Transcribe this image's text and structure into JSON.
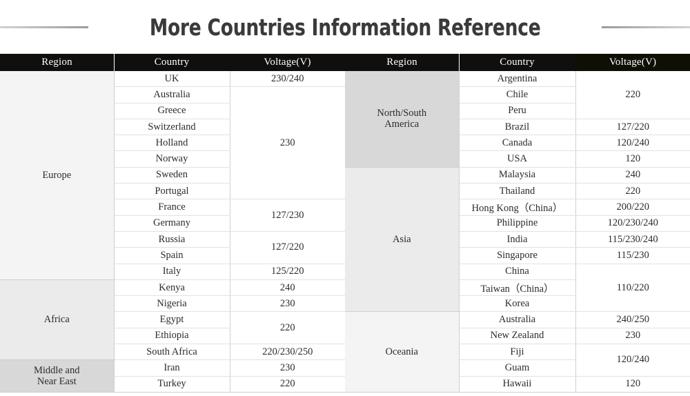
{
  "title": "More Countries Information Reference",
  "headers": {
    "region": "Region",
    "country": "Country",
    "voltage": "Voltage(V)"
  },
  "colors": {
    "header_background": "#100f0d",
    "header_background_tinted": "#100f06",
    "header_text": "#ffffff",
    "title_text": "#3a3a3a",
    "cell_text": "#2b2b2b",
    "grid_line": "#cfcfcf",
    "row_line": "#e2e2e2",
    "region_shade_light": "#f4f4f4",
    "region_shade_mid": "#ebebeb",
    "region_shade_dark": "#d8d8d8",
    "page_background": "#ffffff"
  },
  "left_table": {
    "regions": [
      {
        "label": "Europe",
        "shade": "shade-0",
        "rows": 13
      },
      {
        "label": "Africa",
        "shade": "shade-1",
        "rows": 5
      },
      {
        "label": "Middle and\nNear East",
        "shade": "shade-2",
        "rows": 2
      }
    ],
    "rows": [
      {
        "country": "UK",
        "voltage": "230/240",
        "voltage_rowspan": 1
      },
      {
        "country": "Australia",
        "voltage": "230",
        "voltage_rowspan": 7
      },
      {
        "country": "Greece",
        "voltage": null
      },
      {
        "country": "Switzerland",
        "voltage": null
      },
      {
        "country": "Holland",
        "voltage": null
      },
      {
        "country": "Norway",
        "voltage": null
      },
      {
        "country": "Sweden",
        "voltage": null
      },
      {
        "country": "Portugal",
        "voltage": null
      },
      {
        "country": "France",
        "voltage": "127/230",
        "voltage_rowspan": 2
      },
      {
        "country": "Germany",
        "voltage": null
      },
      {
        "country": "Russia",
        "voltage": "127/220",
        "voltage_rowspan": 2
      },
      {
        "country": "Spain",
        "voltage": null
      },
      {
        "country": "Italy",
        "voltage": "125/220",
        "voltage_rowspan": 1
      },
      {
        "country": "Kenya",
        "voltage": "240",
        "voltage_rowspan": 1
      },
      {
        "country": "Nigeria",
        "voltage": "230",
        "voltage_rowspan": 1
      },
      {
        "country": "Egypt",
        "voltage": "220",
        "voltage_rowspan": 2
      },
      {
        "country": "Ethiopia",
        "voltage": null
      },
      {
        "country": "South Africa",
        "voltage": "220/230/250",
        "voltage_rowspan": 1
      },
      {
        "country": "Iran",
        "voltage": "230",
        "voltage_rowspan": 1
      },
      {
        "country": "Turkey",
        "voltage": "220",
        "voltage_rowspan": 1
      }
    ]
  },
  "right_table": {
    "regions": [
      {
        "label": "North/South\nAmerica",
        "shade": "shade-2",
        "rows": 6
      },
      {
        "label": "Asia",
        "shade": "shade-1",
        "rows": 9
      },
      {
        "label": "Oceania",
        "shade": "shade-0",
        "rows": 5
      }
    ],
    "rows": [
      {
        "country": "Argentina",
        "voltage": "220",
        "voltage_rowspan": 3
      },
      {
        "country": "Chile",
        "voltage": null
      },
      {
        "country": "Peru",
        "voltage": null
      },
      {
        "country": "Brazil",
        "voltage": "127/220",
        "voltage_rowspan": 1
      },
      {
        "country": "Canada",
        "voltage": "120/240",
        "voltage_rowspan": 1
      },
      {
        "country": "USA",
        "voltage": "120",
        "voltage_rowspan": 1
      },
      {
        "country": "Malaysia",
        "voltage": "240",
        "voltage_rowspan": 1
      },
      {
        "country": "Thailand",
        "voltage": "220",
        "voltage_rowspan": 1
      },
      {
        "country": "Hong Kong（China）",
        "voltage": "200/220",
        "voltage_rowspan": 1
      },
      {
        "country": "Philippine",
        "voltage": "120/230/240",
        "voltage_rowspan": 1
      },
      {
        "country": "India",
        "voltage": "115/230/240",
        "voltage_rowspan": 1
      },
      {
        "country": "Singapore",
        "voltage": "115/230",
        "voltage_rowspan": 1
      },
      {
        "country": "China",
        "voltage": "110/220",
        "voltage_rowspan": 3
      },
      {
        "country": "Taiwan（China）",
        "voltage": null
      },
      {
        "country": "Korea",
        "voltage": null
      },
      {
        "country": "Australia",
        "voltage": "240/250",
        "voltage_rowspan": 1
      },
      {
        "country": "New Zealand",
        "voltage": "230",
        "voltage_rowspan": 1
      },
      {
        "country": "Fiji",
        "voltage": "120/240",
        "voltage_rowspan": 2
      },
      {
        "country": "Guam",
        "voltage": null
      },
      {
        "country": "Hawaii",
        "voltage": "120",
        "voltage_rowspan": 1
      }
    ]
  }
}
